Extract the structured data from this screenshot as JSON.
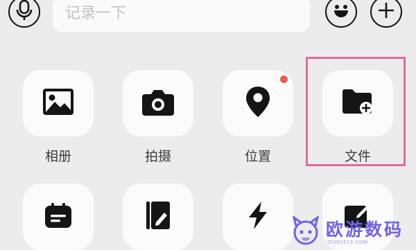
{
  "input": {
    "placeholder": "记录一下"
  },
  "toolbar": [
    {
      "name": "voice-button",
      "icon": "microphone-icon"
    },
    {
      "name": "emoji-button",
      "icon": "smiley-icon"
    },
    {
      "name": "more-button",
      "icon": "plus-icon"
    }
  ],
  "grid": {
    "row1": [
      {
        "label": "相册",
        "icon": "image-icon"
      },
      {
        "label": "拍摄",
        "icon": "camera-icon"
      },
      {
        "label": "位置",
        "icon": "location-pin-icon",
        "badge": true
      },
      {
        "label": "文件",
        "icon": "folder-add-icon",
        "highlighted": true
      }
    ],
    "row2": [
      {
        "icon": "calendar-icon"
      },
      {
        "icon": "notebook-icon"
      },
      {
        "icon": "lightning-icon"
      },
      {
        "icon": "edit-note-icon"
      }
    ]
  },
  "colors": {
    "background": "#ececec",
    "badge": "#ef5a55",
    "highlight": "#e06b9a",
    "watermark": "#6f62e6"
  },
  "watermark": {
    "title": "欧游数码",
    "subtitle": "OYJKS572.COM"
  }
}
